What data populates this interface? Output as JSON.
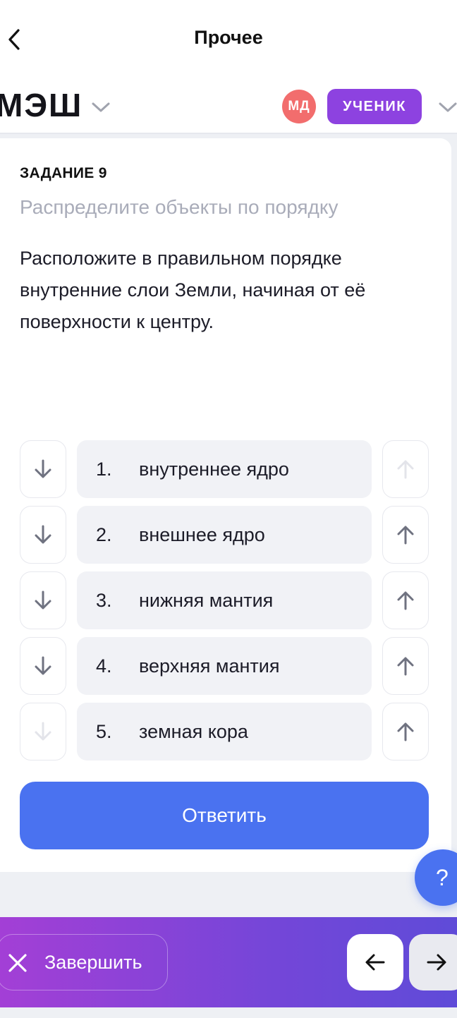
{
  "header": {
    "title": "Прочее",
    "back_icon": "chevron-left-icon"
  },
  "brand": {
    "logo_text": "МЭШ",
    "avatar_initials": "МД",
    "avatar_color": "#f26d6d",
    "role_label": "УЧЕНИК",
    "role_color": "#8d42e0"
  },
  "task": {
    "number_label": "ЗАДАНИЕ 9",
    "subtitle": "Распределите объекты по порядку",
    "text": "Расположите в правильном порядке внутренние слои Земли, начиная от её поверхности к центру.",
    "items": [
      {
        "num": "1.",
        "label": "внутреннее ядро",
        "down_enabled": true,
        "up_enabled": false
      },
      {
        "num": "2.",
        "label": "внешнее ядро",
        "down_enabled": true,
        "up_enabled": true
      },
      {
        "num": "3.",
        "label": "нижняя мантия",
        "down_enabled": true,
        "up_enabled": true
      },
      {
        "num": "4.",
        "label": "верхняя мантия",
        "down_enabled": true,
        "up_enabled": true
      },
      {
        "num": "5.",
        "label": "земная кора",
        "down_enabled": false,
        "up_enabled": true
      }
    ],
    "submit_label": "Ответить"
  },
  "help": {
    "label": "?"
  },
  "footer": {
    "finish_label": "Завершить",
    "prev_icon": "arrow-left-icon",
    "next_icon": "arrow-right-icon"
  },
  "colors": {
    "accent": "#4a72f0",
    "arrow_enabled": "#6f7280",
    "arrow_disabled": "#e3e4ea"
  }
}
